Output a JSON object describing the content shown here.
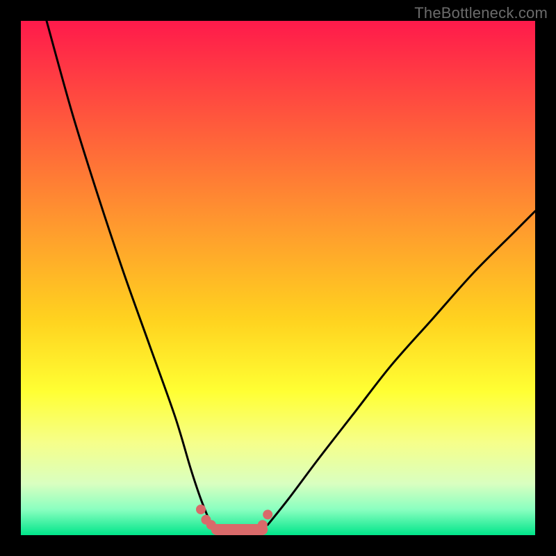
{
  "watermark": "TheBottleneck.com",
  "chart_data": {
    "type": "line",
    "title": "",
    "xlabel": "",
    "ylabel": "",
    "xlim": [
      0,
      100
    ],
    "ylim": [
      0,
      100
    ],
    "grid": false,
    "legend": false,
    "series": [
      {
        "name": "left-curve",
        "x": [
          5,
          10,
          15,
          20,
          25,
          30,
          33,
          35,
          37
        ],
        "y": [
          100,
          82,
          66,
          51,
          37,
          23,
          13,
          7,
          2
        ]
      },
      {
        "name": "right-curve",
        "x": [
          48,
          52,
          58,
          65,
          72,
          80,
          88,
          96,
          100
        ],
        "y": [
          2,
          7,
          15,
          24,
          33,
          42,
          51,
          59,
          63
        ]
      },
      {
        "name": "shoulder-markers",
        "x": [
          35,
          36,
          37,
          38,
          40,
          44,
          46,
          47,
          48
        ],
        "y": [
          5,
          3,
          2,
          1,
          0,
          0,
          1,
          2,
          4
        ]
      },
      {
        "name": "trough-band",
        "x": [
          37,
          48
        ],
        "y": [
          0,
          0
        ]
      }
    ],
    "gradient_stops": [
      {
        "pos": 0.0,
        "color": "#ff1a4b"
      },
      {
        "pos": 0.2,
        "color": "#ff5a3c"
      },
      {
        "pos": 0.4,
        "color": "#ff9a2e"
      },
      {
        "pos": 0.58,
        "color": "#ffd21f"
      },
      {
        "pos": 0.72,
        "color": "#ffff33"
      },
      {
        "pos": 0.82,
        "color": "#f6ff8a"
      },
      {
        "pos": 0.9,
        "color": "#d9ffc0"
      },
      {
        "pos": 0.95,
        "color": "#8affc0"
      },
      {
        "pos": 1.0,
        "color": "#00e58a"
      }
    ],
    "colors": {
      "curve": "#000000",
      "markers": "#d96a6a",
      "trough_band": "#d96a6a"
    }
  }
}
